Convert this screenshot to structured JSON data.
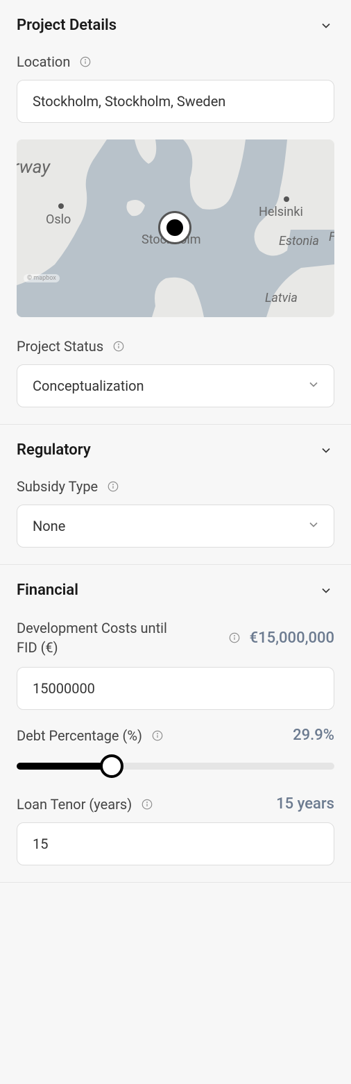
{
  "project_details": {
    "title": "Project Details",
    "location": {
      "label": "Location",
      "value": "Stockholm, Stockholm, Sweden"
    },
    "map": {
      "labels": {
        "norway": "rway",
        "oslo": "Oslo",
        "stockholm": "Stockholm",
        "helsinki": "Helsinki",
        "estonia": "Estonia",
        "latvia": "Latvia",
        "f": "F"
      },
      "attribution": "© mapbox"
    },
    "status": {
      "label": "Project Status",
      "value": "Conceptualization"
    }
  },
  "regulatory": {
    "title": "Regulatory",
    "subsidy_type": {
      "label": "Subsidy Type",
      "value": "None"
    }
  },
  "financial": {
    "title": "Financial",
    "dev_costs": {
      "label": "Development Costs until FID (€)",
      "display": "€15,000,000",
      "value": "15000000"
    },
    "debt_pct": {
      "label": "Debt Percentage (%)",
      "display": "29.9%",
      "percent": 29.9
    },
    "loan_tenor": {
      "label": "Loan Tenor (years)",
      "display": "15 years",
      "value": "15"
    }
  }
}
